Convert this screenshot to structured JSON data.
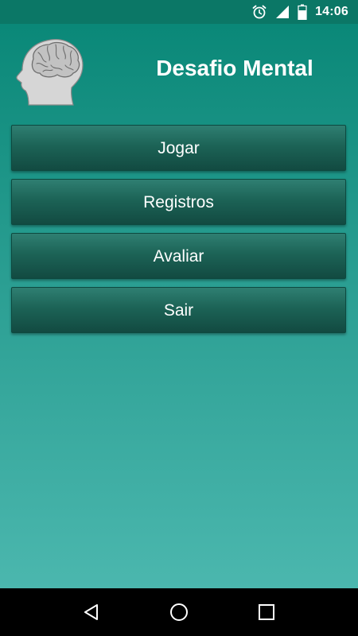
{
  "status_bar": {
    "time": "14:06",
    "icons": [
      "alarm-icon",
      "signal-icon",
      "battery-icon"
    ]
  },
  "app": {
    "title": "Desafio Mental",
    "logo_icon": "brain-head-icon",
    "menu": [
      {
        "label": "Jogar"
      },
      {
        "label": "Registros"
      },
      {
        "label": "Avaliar"
      },
      {
        "label": "Sair"
      }
    ]
  },
  "nav_bar": {
    "icons": [
      "back-icon",
      "home-icon",
      "recents-icon"
    ]
  },
  "colors": {
    "status_bar": "#0b7766",
    "background_top": "#0a8878",
    "background_bottom": "#4bb7ae",
    "button": "#1c6356",
    "text": "#ffffff"
  }
}
